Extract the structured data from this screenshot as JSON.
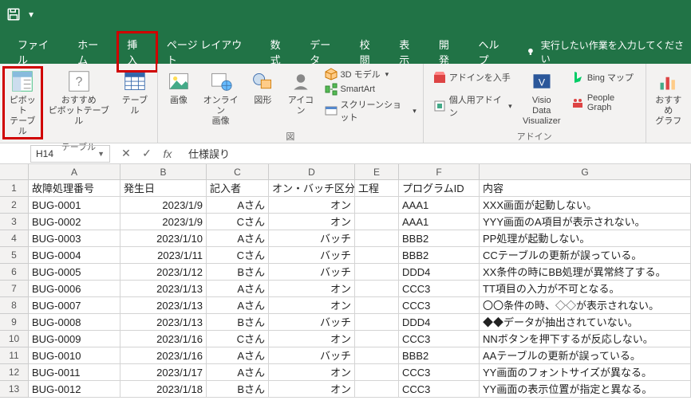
{
  "quickaccess": {
    "save": "save",
    "dd": "▾"
  },
  "tabs": {
    "file": "ファイル",
    "home": "ホーム",
    "insert": "挿入",
    "pagelayout": "ページ レイアウト",
    "formulas": "数式",
    "data": "データ",
    "review": "校閲",
    "view": "表示",
    "developer": "開発",
    "help": "ヘルプ",
    "tellme": "実行したい作業を入力してください"
  },
  "ribbon": {
    "tables_group": "テーブル",
    "pivot": "ピボット\nテーブル",
    "recommend_pivot": "おすすめ\nピボットテーブル",
    "table": "テーブル",
    "illustrations_group": "図",
    "pictures": "画像",
    "online_pictures": "オンライン\n画像",
    "shapes": "図形",
    "icons": "アイコン",
    "3dmodel": "3D モデル",
    "smartart": "SmartArt",
    "screenshot": "スクリーンショット",
    "addins_group": "アドイン",
    "get_addins": "アドインを入手",
    "my_addins": "個人用アドイン",
    "visio": "Visio Data\nVisualizer",
    "bingmaps": "Bing マップ",
    "peoplegraph": "People Graph",
    "recommend_charts": "おすすめ\nグラフ"
  },
  "formula_bar": {
    "namebox": "H14",
    "cancel": "✕",
    "enter": "✓",
    "fx": "fx",
    "content": "仕様誤り"
  },
  "columns": [
    "A",
    "B",
    "C",
    "D",
    "E",
    "F",
    "G"
  ],
  "headers": {
    "A": "故障処理番号",
    "B": "発生日",
    "C": "記入者",
    "D": "オン・バッチ区分",
    "E": "工程",
    "F": "プログラムID",
    "G": "内容"
  },
  "rows": [
    {
      "n": 1,
      "A": "故障処理番号",
      "B": "発生日",
      "C": "記入者",
      "D": "オン・バッチ区分",
      "E": "工程",
      "F": "プログラムID",
      "G": "内容",
      "hdr": true
    },
    {
      "n": 2,
      "A": "BUG-0001",
      "B": "2023/1/9",
      "C": "Aさん",
      "D": "オン",
      "E": "",
      "F": "AAA1",
      "G": "XXX画面が起動しない。"
    },
    {
      "n": 3,
      "A": "BUG-0002",
      "B": "2023/1/9",
      "C": "Cさん",
      "D": "オン",
      "E": "",
      "F": "AAA1",
      "G": "YYY画面のA項目が表示されない。"
    },
    {
      "n": 4,
      "A": "BUG-0003",
      "B": "2023/1/10",
      "C": "Aさん",
      "D": "バッチ",
      "E": "",
      "F": "BBB2",
      "G": "PP処理が起動しない。"
    },
    {
      "n": 5,
      "A": "BUG-0004",
      "B": "2023/1/11",
      "C": "Cさん",
      "D": "バッチ",
      "E": "",
      "F": "BBB2",
      "G": "CCテーブルの更新が誤っている。"
    },
    {
      "n": 6,
      "A": "BUG-0005",
      "B": "2023/1/12",
      "C": "Bさん",
      "D": "バッチ",
      "E": "",
      "F": "DDD4",
      "G": "XX条件の時にBB処理が異常終了する。"
    },
    {
      "n": 7,
      "A": "BUG-0006",
      "B": "2023/1/13",
      "C": "Aさん",
      "D": "オン",
      "E": "",
      "F": "CCC3",
      "G": "TT項目の入力が不可となる。"
    },
    {
      "n": 8,
      "A": "BUG-0007",
      "B": "2023/1/13",
      "C": "Aさん",
      "D": "オン",
      "E": "",
      "F": "CCC3",
      "G": "〇〇条件の時、◇◇が表示されない。"
    },
    {
      "n": 9,
      "A": "BUG-0008",
      "B": "2023/1/13",
      "C": "Bさん",
      "D": "バッチ",
      "E": "",
      "F": "DDD4",
      "G": "◆◆データが抽出されていない。"
    },
    {
      "n": 10,
      "A": "BUG-0009",
      "B": "2023/1/16",
      "C": "Cさん",
      "D": "オン",
      "E": "",
      "F": "CCC3",
      "G": "NNボタンを押下するが反応しない。"
    },
    {
      "n": 11,
      "A": "BUG-0010",
      "B": "2023/1/16",
      "C": "Aさん",
      "D": "バッチ",
      "E": "",
      "F": "BBB2",
      "G": "AAテーブルの更新が誤っている。"
    },
    {
      "n": 12,
      "A": "BUG-0011",
      "B": "2023/1/17",
      "C": "Aさん",
      "D": "オン",
      "E": "",
      "F": "CCC3",
      "G": "YY画面のフォントサイズが異なる。"
    },
    {
      "n": 13,
      "A": "BUG-0012",
      "B": "2023/1/18",
      "C": "Bさん",
      "D": "オン",
      "E": "",
      "F": "CCC3",
      "G": "YY画面の表示位置が指定と異なる。"
    }
  ]
}
